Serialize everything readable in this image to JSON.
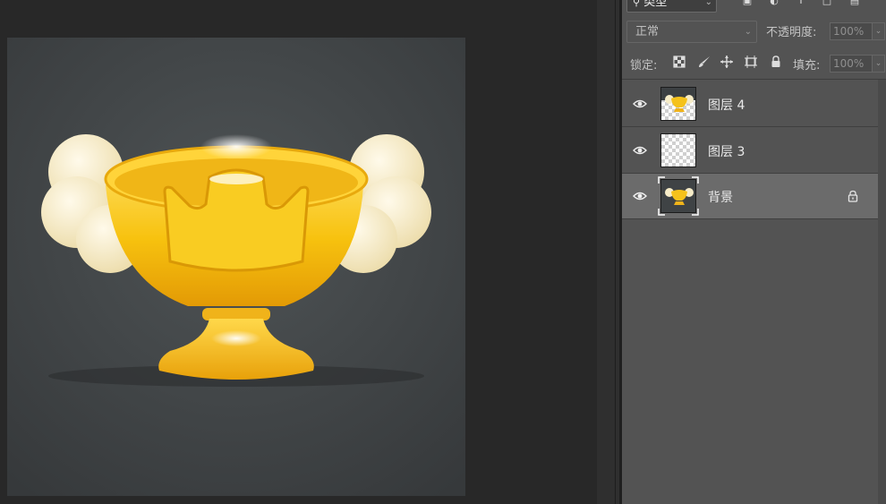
{
  "toolbar": {
    "filter_type": "类型",
    "filter_icons": [
      "image-filter-icon",
      "adjustment-filter-icon",
      "type-filter-icon",
      "shape-filter-icon",
      "smart-object-filter-icon"
    ]
  },
  "blend": {
    "mode": "正常",
    "opacity_label": "不透明度:",
    "opacity_value": "100%"
  },
  "lock": {
    "label": "锁定:",
    "fill_label": "填充:",
    "fill_value": "100%",
    "icons": [
      "lock-transparent-pixels-icon",
      "lock-image-pixels-icon",
      "lock-position-icon",
      "lock-artboard-icon",
      "lock-all-icon"
    ]
  },
  "layers": [
    {
      "name": "图层 4",
      "visible": true,
      "selected": false,
      "locked": false,
      "thumbnail": "trophy-transparent"
    },
    {
      "name": "图层 3",
      "visible": true,
      "selected": false,
      "locked": false,
      "thumbnail": "transparent"
    },
    {
      "name": "背景",
      "visible": true,
      "selected": true,
      "locked": true,
      "thumbnail": "trophy-dark"
    }
  ],
  "colors": {
    "panel_bg": "#535353",
    "selected_row": "#6b6b6b",
    "canvas_bg": "#282828",
    "trophy_gold": "#f5c21b",
    "cloud_cream": "#f6ecc8"
  }
}
